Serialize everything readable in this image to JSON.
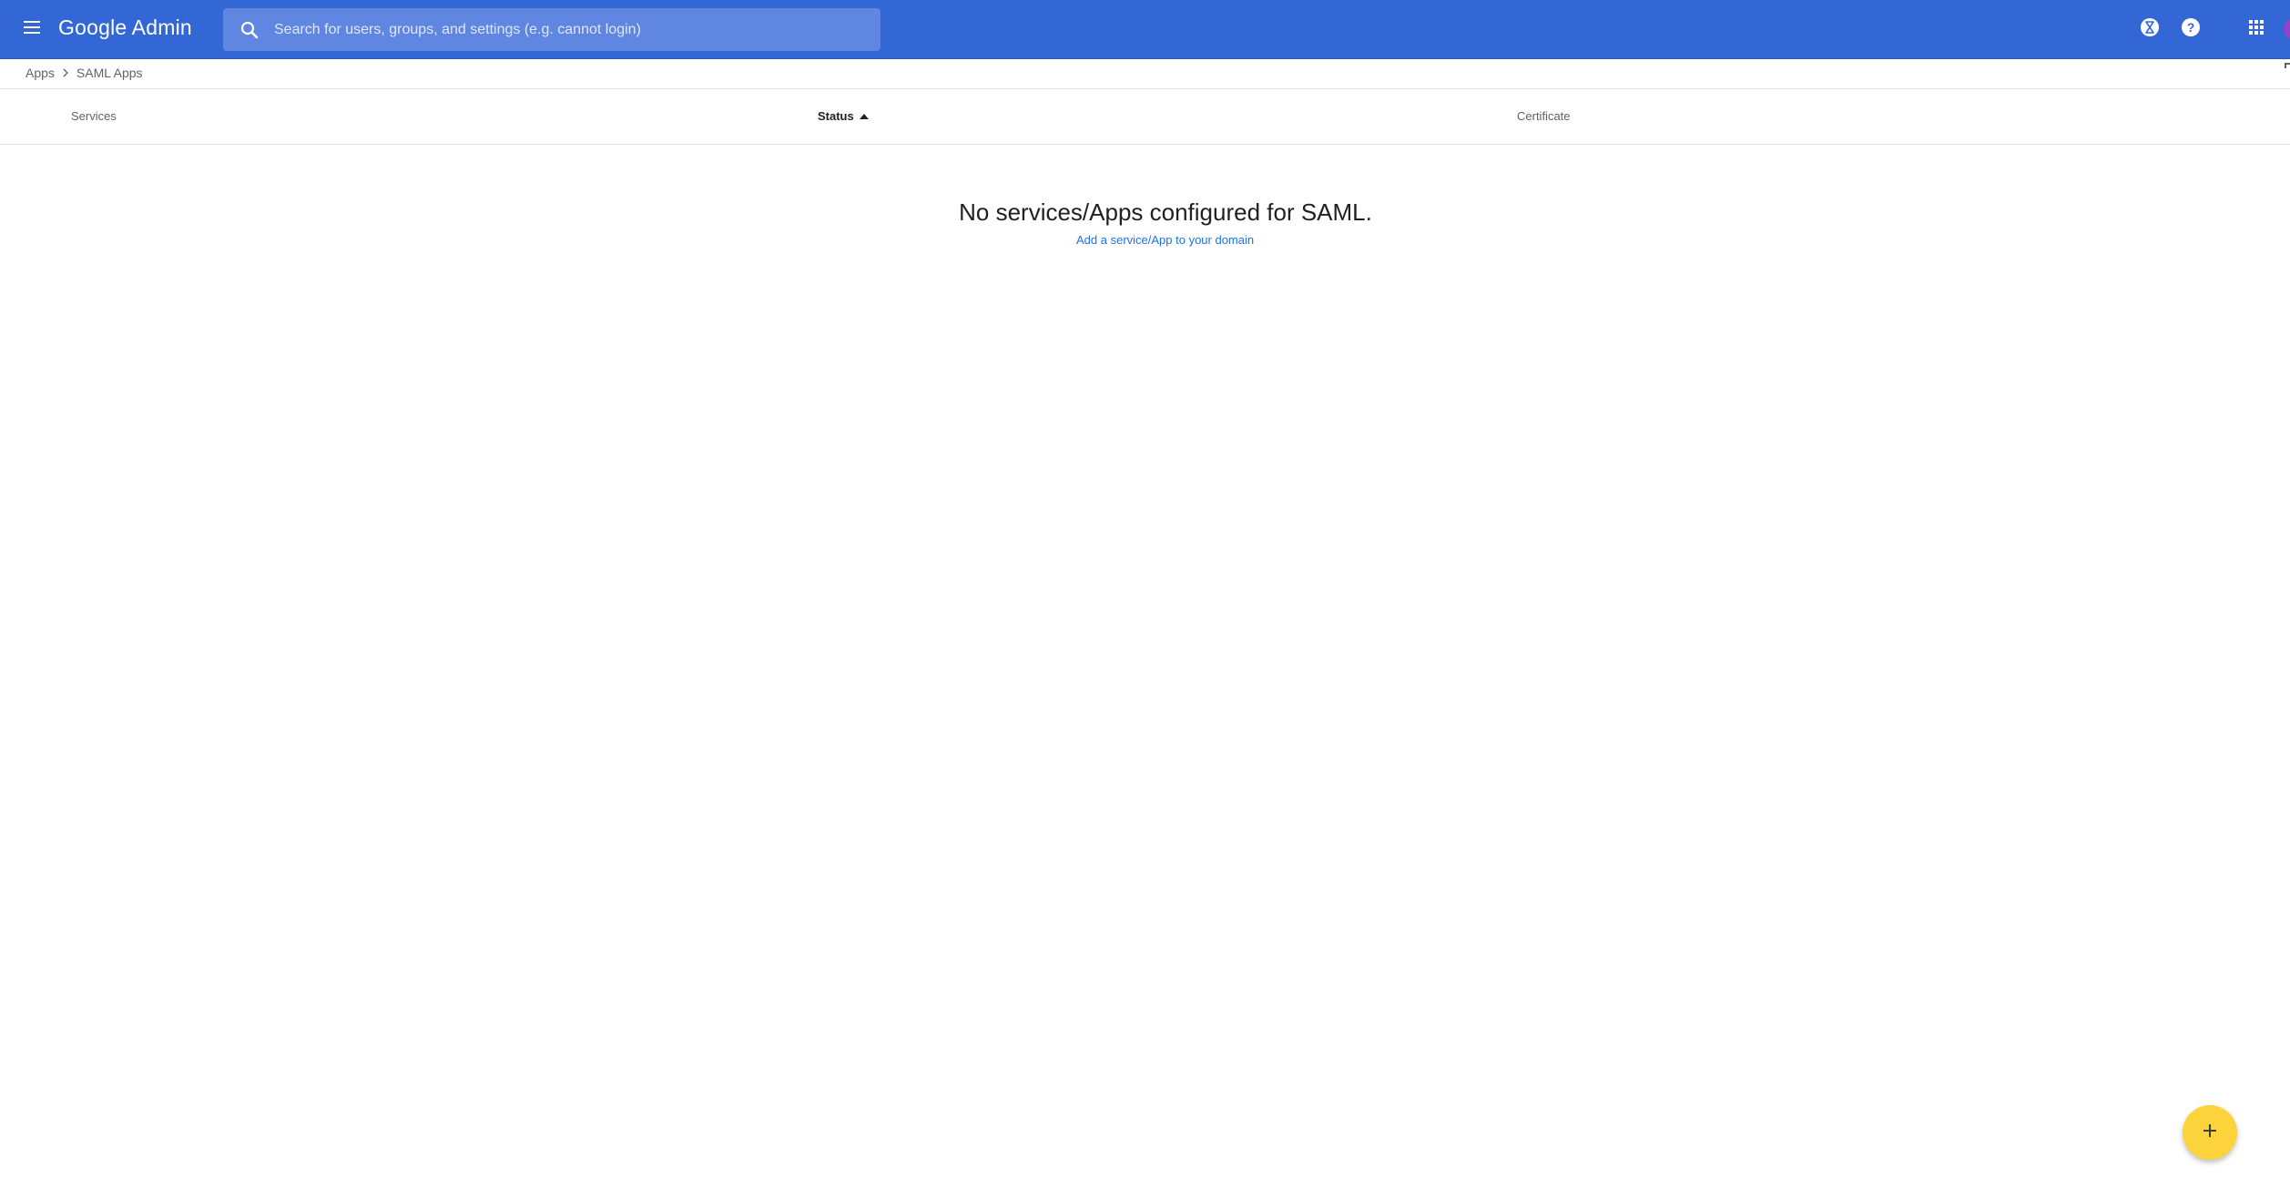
{
  "appbar": {
    "title": "Google Admin",
    "search_placeholder": "Search for users, groups, and settings (e.g. cannot login)",
    "background_color": "#3367d6",
    "icons": [
      "menu-icon",
      "search-icon",
      "hourglass-icon",
      "help-icon",
      "apps-grid-icon"
    ]
  },
  "breadcrumb": {
    "items": [
      "Apps",
      "SAML Apps"
    ]
  },
  "table": {
    "columns": [
      "Services",
      "Status",
      "Certificate"
    ],
    "sorted_column": "Status",
    "sort_direction": "ascending"
  },
  "empty_state": {
    "message": "No services/Apps configured for SAML.",
    "link_label": "Add a service/App to your domain",
    "link_color": "#1a73e8"
  },
  "fab": {
    "icon": "plus-icon",
    "color": "#fcd33a"
  }
}
